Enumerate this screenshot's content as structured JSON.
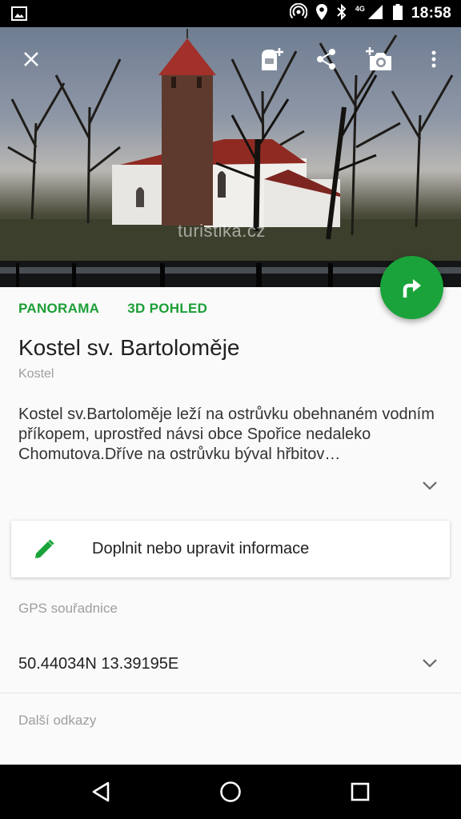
{
  "status_bar": {
    "time": "18:58",
    "network": "4G",
    "icons": [
      "image-icon",
      "hotspot-icon",
      "location-icon",
      "bluetooth-icon",
      "signal-icon",
      "battery-icon"
    ]
  },
  "hero": {
    "watermark": "turistika.cz",
    "actions": [
      "close-icon",
      "add-to-backpack-icon",
      "share-icon",
      "add-photo-icon",
      "more-icon"
    ]
  },
  "tabs": [
    {
      "label": "PANORAMA"
    },
    {
      "label": "3D POHLED"
    }
  ],
  "place": {
    "title": "Kostel sv. Bartoloměje",
    "category": "Kostel",
    "description": "Kostel sv.Bartoloměje leží na ostrůvku obehnaném vodním příkopem, uprostřed návsi obce Spořice nedaleko Chomutova.Dříve na ostrůvku býval hřbitov…"
  },
  "edit": {
    "label": "Doplnit nebo upravit informace"
  },
  "gps": {
    "label": "GPS souřadnice",
    "value": "50.44034N 13.39195E"
  },
  "links": {
    "label": "Další odkazy"
  },
  "colors": {
    "accent": "#1aa33a",
    "accent_text": "#1c9e37"
  }
}
